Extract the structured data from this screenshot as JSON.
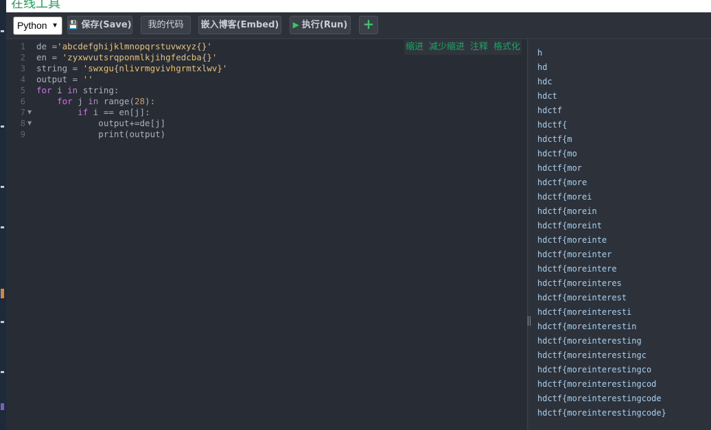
{
  "header": {
    "title": "在线工具"
  },
  "toolbar": {
    "language": "Python",
    "save_label": "保存(Save)",
    "my_code_label": "我的代码",
    "embed_label": "嵌入博客(Embed)",
    "run_label": "执行(Run)",
    "add_label": "+"
  },
  "editor": {
    "actions": [
      "缩进",
      "减少缩进",
      "注释",
      "格式化"
    ],
    "line_numbers": [
      "1",
      "2",
      "3",
      "4",
      "5",
      "6",
      "7",
      "8",
      "9"
    ],
    "lines": [
      [
        {
          "t": "de =",
          "c": "plain"
        },
        {
          "t": "'abcdefghijklmnopqrstuvwxyz{}'",
          "c": "st"
        }
      ],
      [
        {
          "t": "en = ",
          "c": "plain"
        },
        {
          "t": "'zyxwvutsrqponmlkjihgfedcba{}'",
          "c": "st"
        }
      ],
      [
        {
          "t": "string = ",
          "c": "plain"
        },
        {
          "t": "'swxgu{nlivrmgvivhgrmtxlwv}'",
          "c": "st"
        }
      ],
      [
        {
          "t": "output = ",
          "c": "plain"
        },
        {
          "t": "''",
          "c": "st"
        }
      ],
      [
        {
          "t": "for",
          "c": "kw"
        },
        {
          "t": " i ",
          "c": "plain"
        },
        {
          "t": "in",
          "c": "kw"
        },
        {
          "t": " string:",
          "c": "plain"
        }
      ],
      [
        {
          "t": "    ",
          "c": "plain"
        },
        {
          "t": "for",
          "c": "kw"
        },
        {
          "t": " j ",
          "c": "plain"
        },
        {
          "t": "in",
          "c": "kw"
        },
        {
          "t": " range(",
          "c": "plain"
        },
        {
          "t": "28",
          "c": "nm"
        },
        {
          "t": "):",
          "c": "plain"
        }
      ],
      [
        {
          "t": "        ",
          "c": "plain"
        },
        {
          "t": "if",
          "c": "kw"
        },
        {
          "t": " i == en[j]:",
          "c": "plain"
        }
      ],
      [
        {
          "t": "            output+=de[j]",
          "c": "plain"
        }
      ],
      [
        {
          "t": "            print(output)",
          "c": "plain"
        }
      ]
    ]
  },
  "output": {
    "lines": [
      "h",
      "hd",
      "hdc",
      "hdct",
      "hdctf",
      "hdctf{",
      "hdctf{m",
      "hdctf{mo",
      "hdctf{mor",
      "hdctf{more",
      "hdctf{morei",
      "hdctf{morein",
      "hdctf{moreint",
      "hdctf{moreinte",
      "hdctf{moreinter",
      "hdctf{moreintere",
      "hdctf{moreinteres",
      "hdctf{moreinterest",
      "hdctf{moreinteresti",
      "hdctf{moreinterestin",
      "hdctf{moreinteresting",
      "hdctf{moreinterestingc",
      "hdctf{moreinterestingco",
      "hdctf{moreinterestingcod",
      "hdctf{moreinterestingcode",
      "hdctf{moreinterestingcode}"
    ]
  },
  "colors": {
    "keyword": "#c678dd",
    "string": "#e5c07b",
    "number": "#d19a66",
    "accent_green": "#21a366",
    "output_text": "#a9d1ef"
  }
}
